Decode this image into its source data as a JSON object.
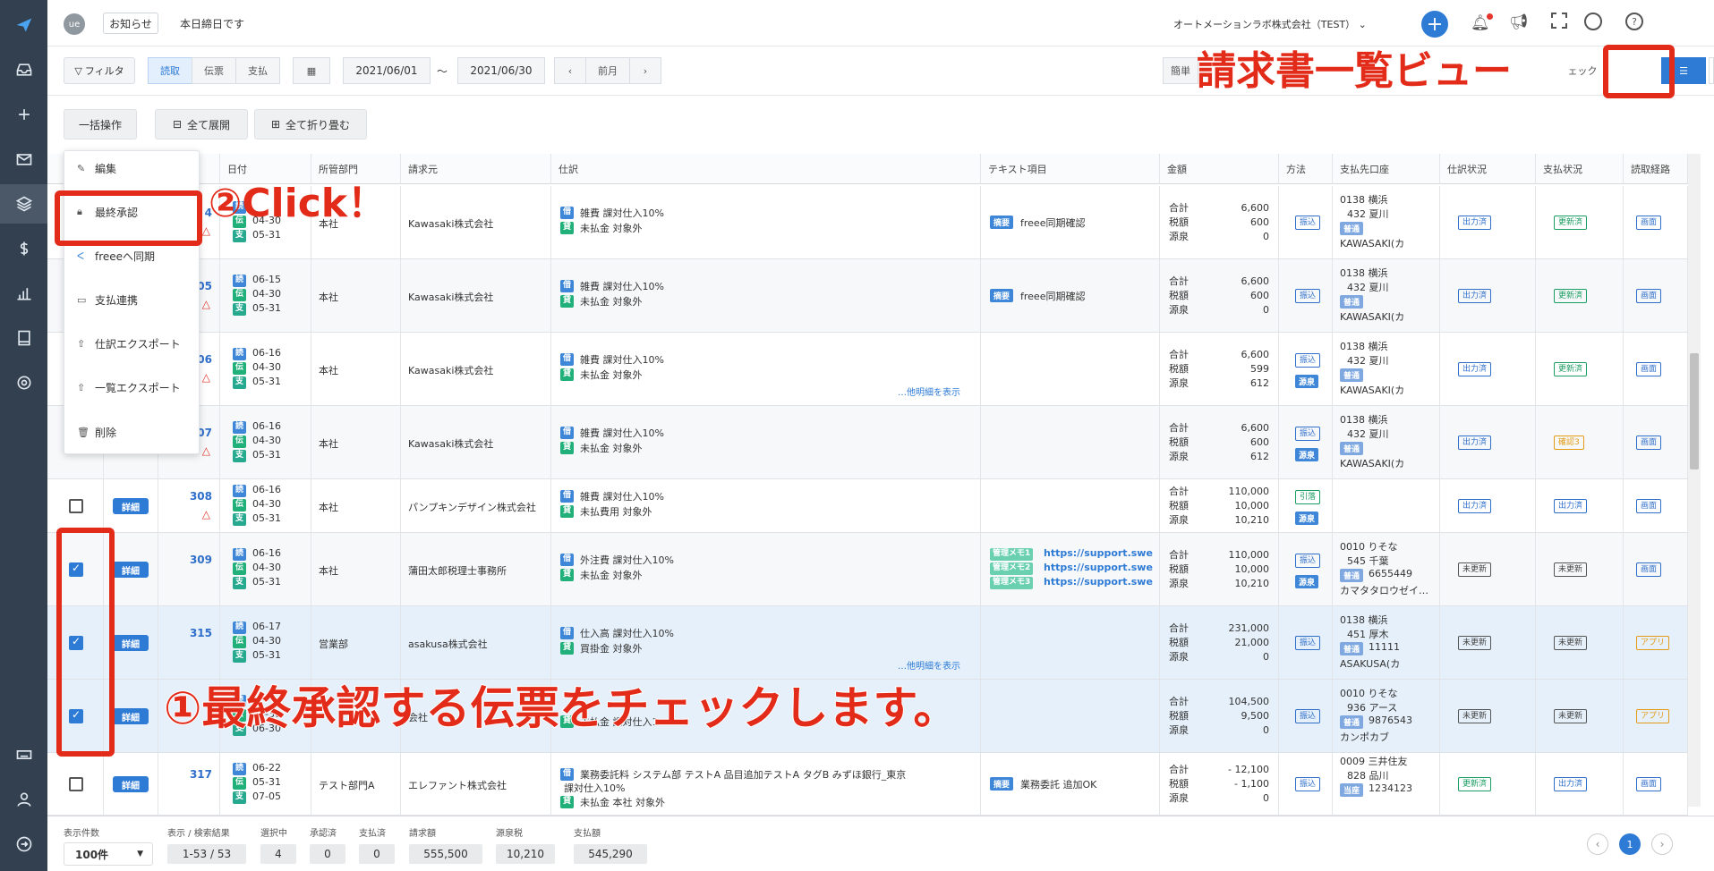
{
  "header": {
    "user_initials": "ue",
    "notice_button": "お知らせ",
    "notice_text": "本日締日です",
    "company": "オートメーションラボ株式会社（TEST）"
  },
  "toolbar": {
    "filter": "フィルタ",
    "tabs": [
      "読取",
      "伝票",
      "支払"
    ],
    "date_from": "2021/06/01",
    "date_sep": "〜",
    "date_to": "2021/06/30",
    "prev_month": "前月",
    "simple": "簡単",
    "check": "ェック"
  },
  "actions": {
    "bulk": "一括操作",
    "expand_all": "全て展開",
    "collapse_all": "全て折り畳む"
  },
  "menu": {
    "items": [
      "編集",
      "最終承認",
      "freeeへ同期",
      "支払連携",
      "仕訳エクスポート",
      "一覧エクスポート",
      "削除"
    ]
  },
  "columns": [
    "日付",
    "所管部門",
    "請求元",
    "仕訳",
    "テキスト項目",
    "金額",
    "方法",
    "支払先口座",
    "仕訳状況",
    "支払状況",
    "読取経路"
  ],
  "col_no_partial": ".",
  "detail_label": "詳細",
  "amount_labels": [
    "合計",
    "税額",
    "源泉"
  ],
  "more_detail": "…他明細を表示",
  "rows": [
    {
      "no": "4",
      "dates": [
        "",
        "04-30",
        "05-31"
      ],
      "dept": "本社",
      "vendor": "Kawasaki株式会社",
      "j1": "雑費 課対仕入10%",
      "j2": "未払金 対象外",
      "text_tag": "摘要",
      "text": "freee同期確認",
      "amounts": [
        "6,600",
        "600",
        "0"
      ],
      "method": [
        "振込"
      ],
      "bank1": "0138 横浜",
      "bank2": "432 夏川",
      "bank_type": "普通",
      "bank_name": "KAWASAKI(カ",
      "jstatus": "出力済",
      "pstatus": "更新済",
      "route": "画面"
    },
    {
      "no": "05",
      "dates": [
        "06-15",
        "04-30",
        "05-31"
      ],
      "dept": "本社",
      "vendor": "Kawasaki株式会社",
      "j1": "雑費 課対仕入10%",
      "j2": "未払金 対象外",
      "text_tag": "摘要",
      "text": "freee同期確認",
      "amounts": [
        "6,600",
        "600",
        "0"
      ],
      "method": [
        "振込"
      ],
      "bank1": "0138 横浜",
      "bank2": "432 夏川",
      "bank_type": "普通",
      "bank_name": "KAWASAKI(カ",
      "jstatus": "出力済",
      "pstatus": "更新済",
      "route": "画面"
    },
    {
      "no": "06",
      "dates": [
        "06-16",
        "04-30",
        "05-31"
      ],
      "dept": "本社",
      "vendor": "Kawasaki株式会社",
      "j1": "雑費 課対仕入10%",
      "j2": "未払金 対象外",
      "text_tag": "",
      "text": "",
      "amounts": [
        "6,600",
        "599",
        "612"
      ],
      "method": [
        "振込",
        "源泉"
      ],
      "bank1": "0138 横浜",
      "bank2": "432 夏川",
      "bank_type": "普通",
      "bank_name": "KAWASAKI(カ",
      "jstatus": "出力済",
      "pstatus": "更新済",
      "route": "画面"
    },
    {
      "no": "07",
      "dates": [
        "06-16",
        "04-30",
        "05-31"
      ],
      "dept": "本社",
      "vendor": "Kawasaki株式会社",
      "j1": "雑費 課対仕入10%",
      "j2": "未払金 対象外",
      "text_tag": "",
      "text": "",
      "amounts": [
        "6,600",
        "600",
        "612"
      ],
      "method": [
        "振込",
        "源泉"
      ],
      "bank1": "0138 横浜",
      "bank2": "432 夏川",
      "bank_type": "普通",
      "bank_name": "KAWASAKI(カ",
      "jstatus": "出力済",
      "pstatus": "確認3",
      "route": "画面"
    },
    {
      "no": "308",
      "dates": [
        "06-16",
        "04-30",
        "05-31"
      ],
      "dept": "本社",
      "vendor": "パンプキンデザイン株式会社",
      "j1": "雑費 課対仕入10%",
      "j2": "未払費用 対象外",
      "text_tag": "",
      "text": "",
      "amounts": [
        "110,000",
        "10,000",
        "10,210"
      ],
      "method": [
        "引落",
        "源泉"
      ],
      "bank1": "",
      "bank2": "",
      "bank_type": "",
      "bank_name": "",
      "jstatus": "出力済",
      "pstatus": "出力済",
      "route": "画面"
    },
    {
      "no": "309",
      "dates": [
        "06-16",
        "04-30",
        "05-31"
      ],
      "dept": "本社",
      "vendor": "蒲田太郎税理士事務所",
      "j1": "外注費 課対仕入10%",
      "j2": "未払金 対象外",
      "text_memos": [
        "管理メモ1",
        "管理メモ2",
        "管理メモ3"
      ],
      "text_link": "https://support.swe",
      "amounts": [
        "110,000",
        "10,000",
        "10,210"
      ],
      "method": [
        "振込",
        "源泉"
      ],
      "bank1": "0010 りそな",
      "bank2": "545 千葉",
      "bank_type": "普通",
      "bank_acct": "6655449",
      "bank_name": "カマタタロウゼイ…",
      "jstatus": "未更新",
      "pstatus": "未更新",
      "route": "画面"
    },
    {
      "no": "315",
      "dates": [
        "06-17",
        "04-30",
        "05-31"
      ],
      "dept": "営業部",
      "vendor": "asakusa株式会社",
      "j1": "仕入高 課対仕入10%",
      "j2": "買掛金 対象外",
      "amounts": [
        "231,000",
        "21,000",
        "0"
      ],
      "method": [
        "振込"
      ],
      "bank1": "0138 横浜",
      "bank2": "451 厚木",
      "bank_type": "普通",
      "bank_acct": "11111",
      "bank_name": "ASAKUSA(カ",
      "jstatus": "未更新",
      "pstatus": "未更新",
      "route": "アプリ"
    },
    {
      "no": "",
      "dates": [
        "",
        "04-30",
        "06-30"
      ],
      "dept": "",
      "vendor": "会社",
      "j1": "",
      "j2": "未払金 課対仕入1",
      "amounts": [
        "104,500",
        "9,500",
        "0"
      ],
      "method": [
        "振込"
      ],
      "bank1": "0010 りそな",
      "bank2": "936 アース",
      "bank_type": "普通",
      "bank_acct": "9876543",
      "bank_name": "カンポカブ",
      "jstatus": "未更新",
      "pstatus": "未更新",
      "route": "アプリ"
    },
    {
      "no": "317",
      "dates": [
        "06-22",
        "05-31",
        "07-05"
      ],
      "dept": "テスト部門A",
      "vendor": "エレファント株式会社",
      "j1": "業務委託料 システム部 テストA 品目追加テストA タグB みずほ銀行_東京",
      "j1b": "課対仕入10%",
      "j2": "未払金 本社 対象外",
      "text_tag": "摘要",
      "text": "業務委託 追加OK",
      "amounts": [
        "- 12,100",
        "- 1,100",
        "0"
      ],
      "method": [
        "振込"
      ],
      "bank1": "0009 三井住友",
      "bank2": "828 品川",
      "bank_type": "当座",
      "bank_acct": "1234123",
      "bank_name": "",
      "jstatus": "更新済",
      "pstatus": "出力済",
      "route": "画面"
    }
  ],
  "footer": {
    "count_label": "表示件数",
    "count_value": "100件",
    "range_label": "表示 / 検索結果",
    "range_value": "1-53 / 53",
    "selected_label": "選択中",
    "selected_value": "4",
    "approved_label": "承認済",
    "approved_value": "0",
    "paid_label": "支払済",
    "paid_value": "0",
    "invoice_label": "請求額",
    "invoice_value": "555,500",
    "withholding_label": "源泉税",
    "withholding_value": "10,210",
    "payment_label": "支払額",
    "payment_value": "545,290",
    "page": "1"
  },
  "annotations": {
    "title": "請求書一覧ビュー",
    "click": "②Click！",
    "instruction": "①最終承認する伝票をチェックします。"
  },
  "colors": {
    "accent": "#2e7bd6",
    "sidebar": "#33404f",
    "annotation": "#e32b1a"
  }
}
